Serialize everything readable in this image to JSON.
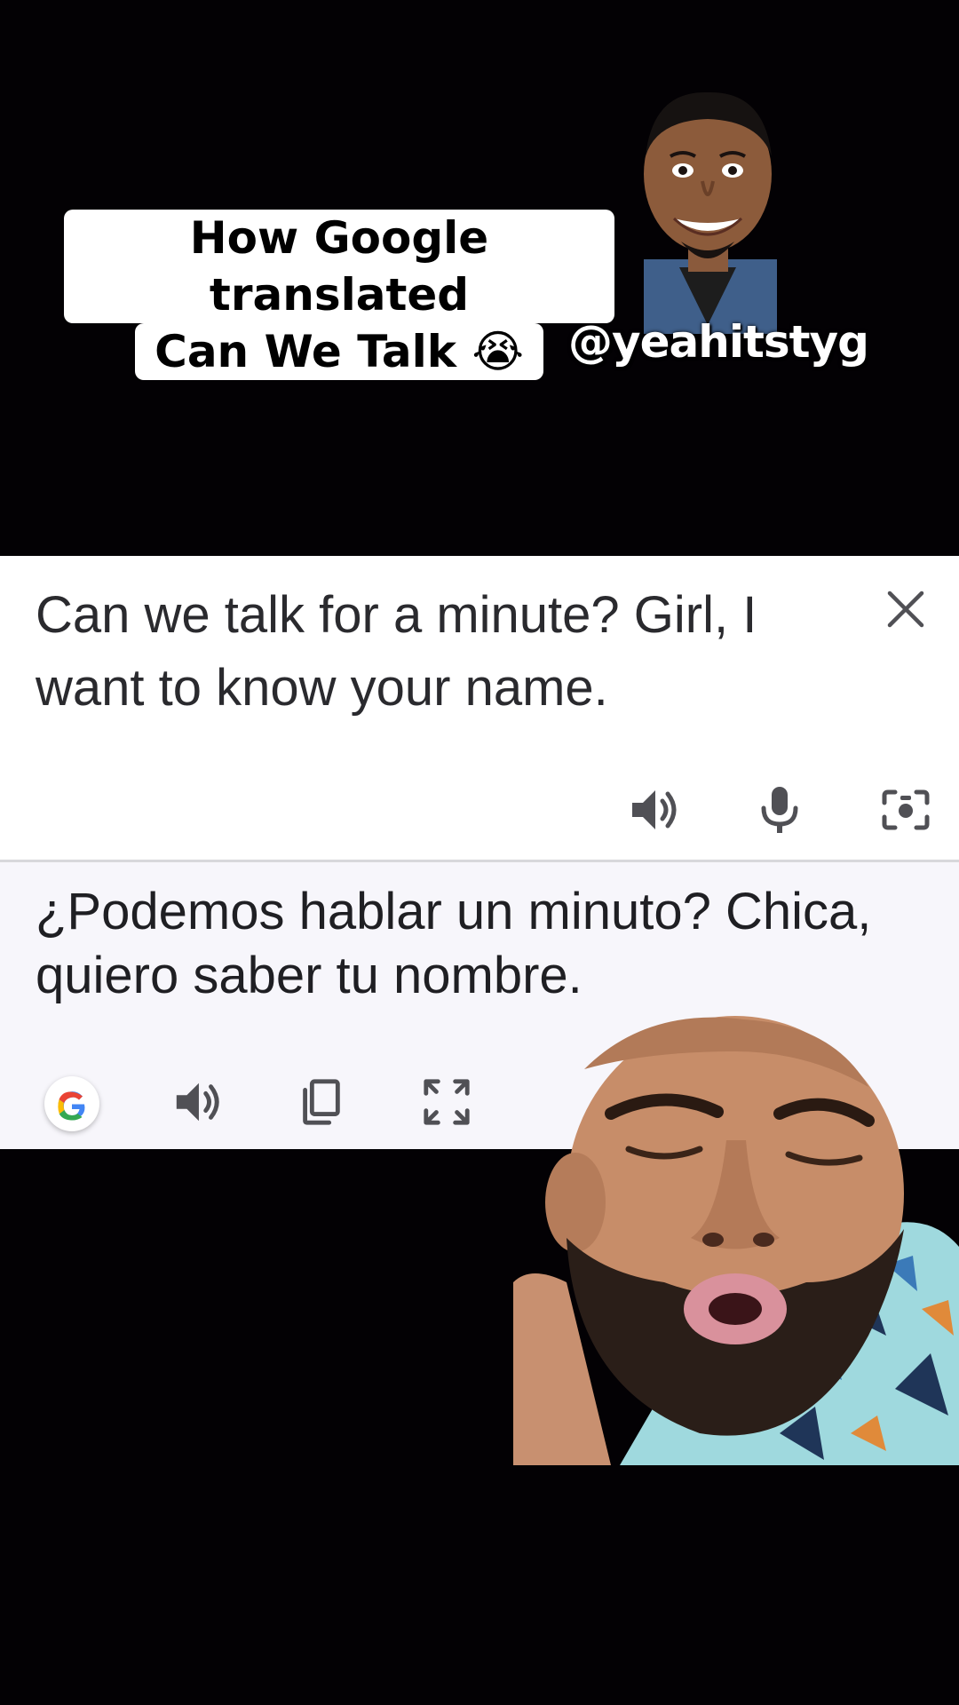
{
  "caption": {
    "line1": "How Google translated",
    "line2": "Can We Talk 😭"
  },
  "creator": {
    "handle": "@yeahitstyg"
  },
  "translate": {
    "source_text": "Can we talk for a minute? Girl, I want to know your name.",
    "translated_text": "¿Podemos hablar un minuto? Chica, quiero saber tu nombre.",
    "source_icons": [
      "close-icon",
      "speaker-icon",
      "microphone-icon",
      "camera-icon"
    ],
    "target_icons": [
      "google-logo-icon",
      "speaker-icon",
      "copy-icon",
      "fullscreen-icon"
    ]
  },
  "colors": {
    "background": "#030104",
    "card_source": "#ffffff",
    "card_target": "#f7f6fb",
    "icon_gray": "#505055",
    "google_blue": "#4285F4",
    "google_red": "#EA4335",
    "google_yellow": "#FBBC05",
    "google_green": "#34A853"
  }
}
